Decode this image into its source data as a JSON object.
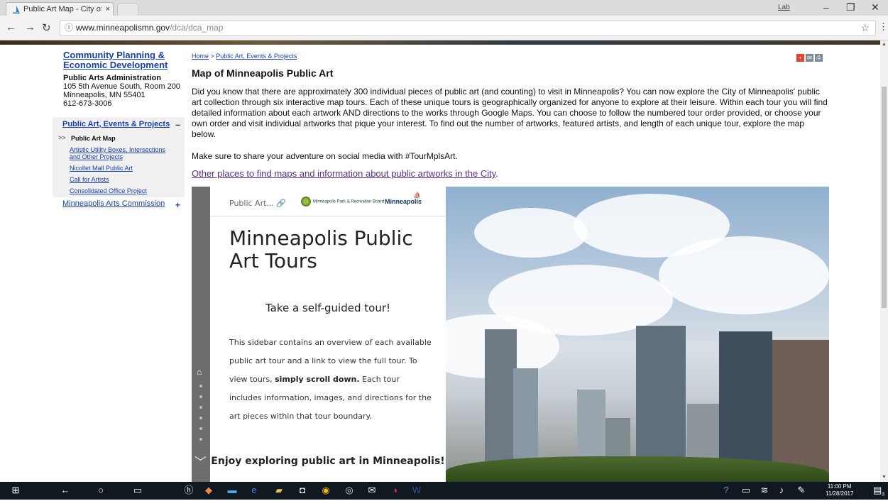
{
  "browser": {
    "tab_title": "Public Art Map - City of |",
    "tab_close": "×",
    "user_badge": "Lab",
    "url_host": "www.minneapolismn.gov",
    "url_path": "/dca/dca_map"
  },
  "left_nav": {
    "org_link": "Community Planning & Economic Development",
    "dept_name": "Public Arts Administration",
    "address_line1": "105 5th Avenue South, Room 200",
    "address_line2": "Minneapolis, MN 55401",
    "phone": "612-673-3006",
    "section_heading": "Public Art, Events & Projects",
    "collapse_symbol": "–",
    "active_marker": ">>",
    "active_item": "Public Art Map",
    "items": [
      "Artistic Utility Boxes, Intersections and Other Projects",
      "Nicollet Mall Public Art",
      "Call for Artists",
      "Consolidated Office Project"
    ],
    "arts_commission": "Minneapolis Arts Commission",
    "expand_symbol": "+"
  },
  "main": {
    "breadcrumb_home": "Home",
    "breadcrumb_sep": " > ",
    "breadcrumb_section": "Public Art, Events & Projects",
    "title": "Map of Minneapolis Public Art",
    "intro": " Did you know that there are approximately 300 individual pieces of public art (and counting) to visit in Minneapolis? You can now explore the City of Minneapolis' public art collection through six interactive map tours. Each of these unique tours is geographically organized for anyone to explore at their leisure. Within each tour you will find detailed information about each artwork AND directions to the works through Google Maps. You can choose to follow the numbered tour order provided, or choose your own order and visit individual artworks that pique your interest. To find out the number of artworks, featured artists, and length of each unique tour, explore the map below.",
    "share_line": "Make sure to share your adventure on social media with #TourMplsArt.",
    "other_link": "Other places to find maps and information about public artworks in the City",
    "other_link_suffix": "."
  },
  "embed": {
    "short_title": "Public Art...",
    "park_board": "Minneapolis Park & Recreation Board",
    "city_logo": "Minneapolis",
    "title": "Minneapolis Public Art Tours",
    "subtitle": "Take a self-guided tour!",
    "body_pre": "This sidebar contains an overview of each available public art tour and a link to view the full tour. To view tours, ",
    "body_bold": "simply scroll down.",
    "body_post": " Each tour includes information, images, and directions for the art pieces within that tour boundary.",
    "enjoy": "Enjoy exploring public art in Minneapolis!"
  },
  "taskbar": {
    "time": "11:00 PM",
    "date": "11/28/2017",
    "notification_count": "3"
  },
  "colors": {
    "link_blue": "#1a3fb2",
    "visited_purple": "#5a2d91",
    "taskbar_bg": "#101820"
  }
}
